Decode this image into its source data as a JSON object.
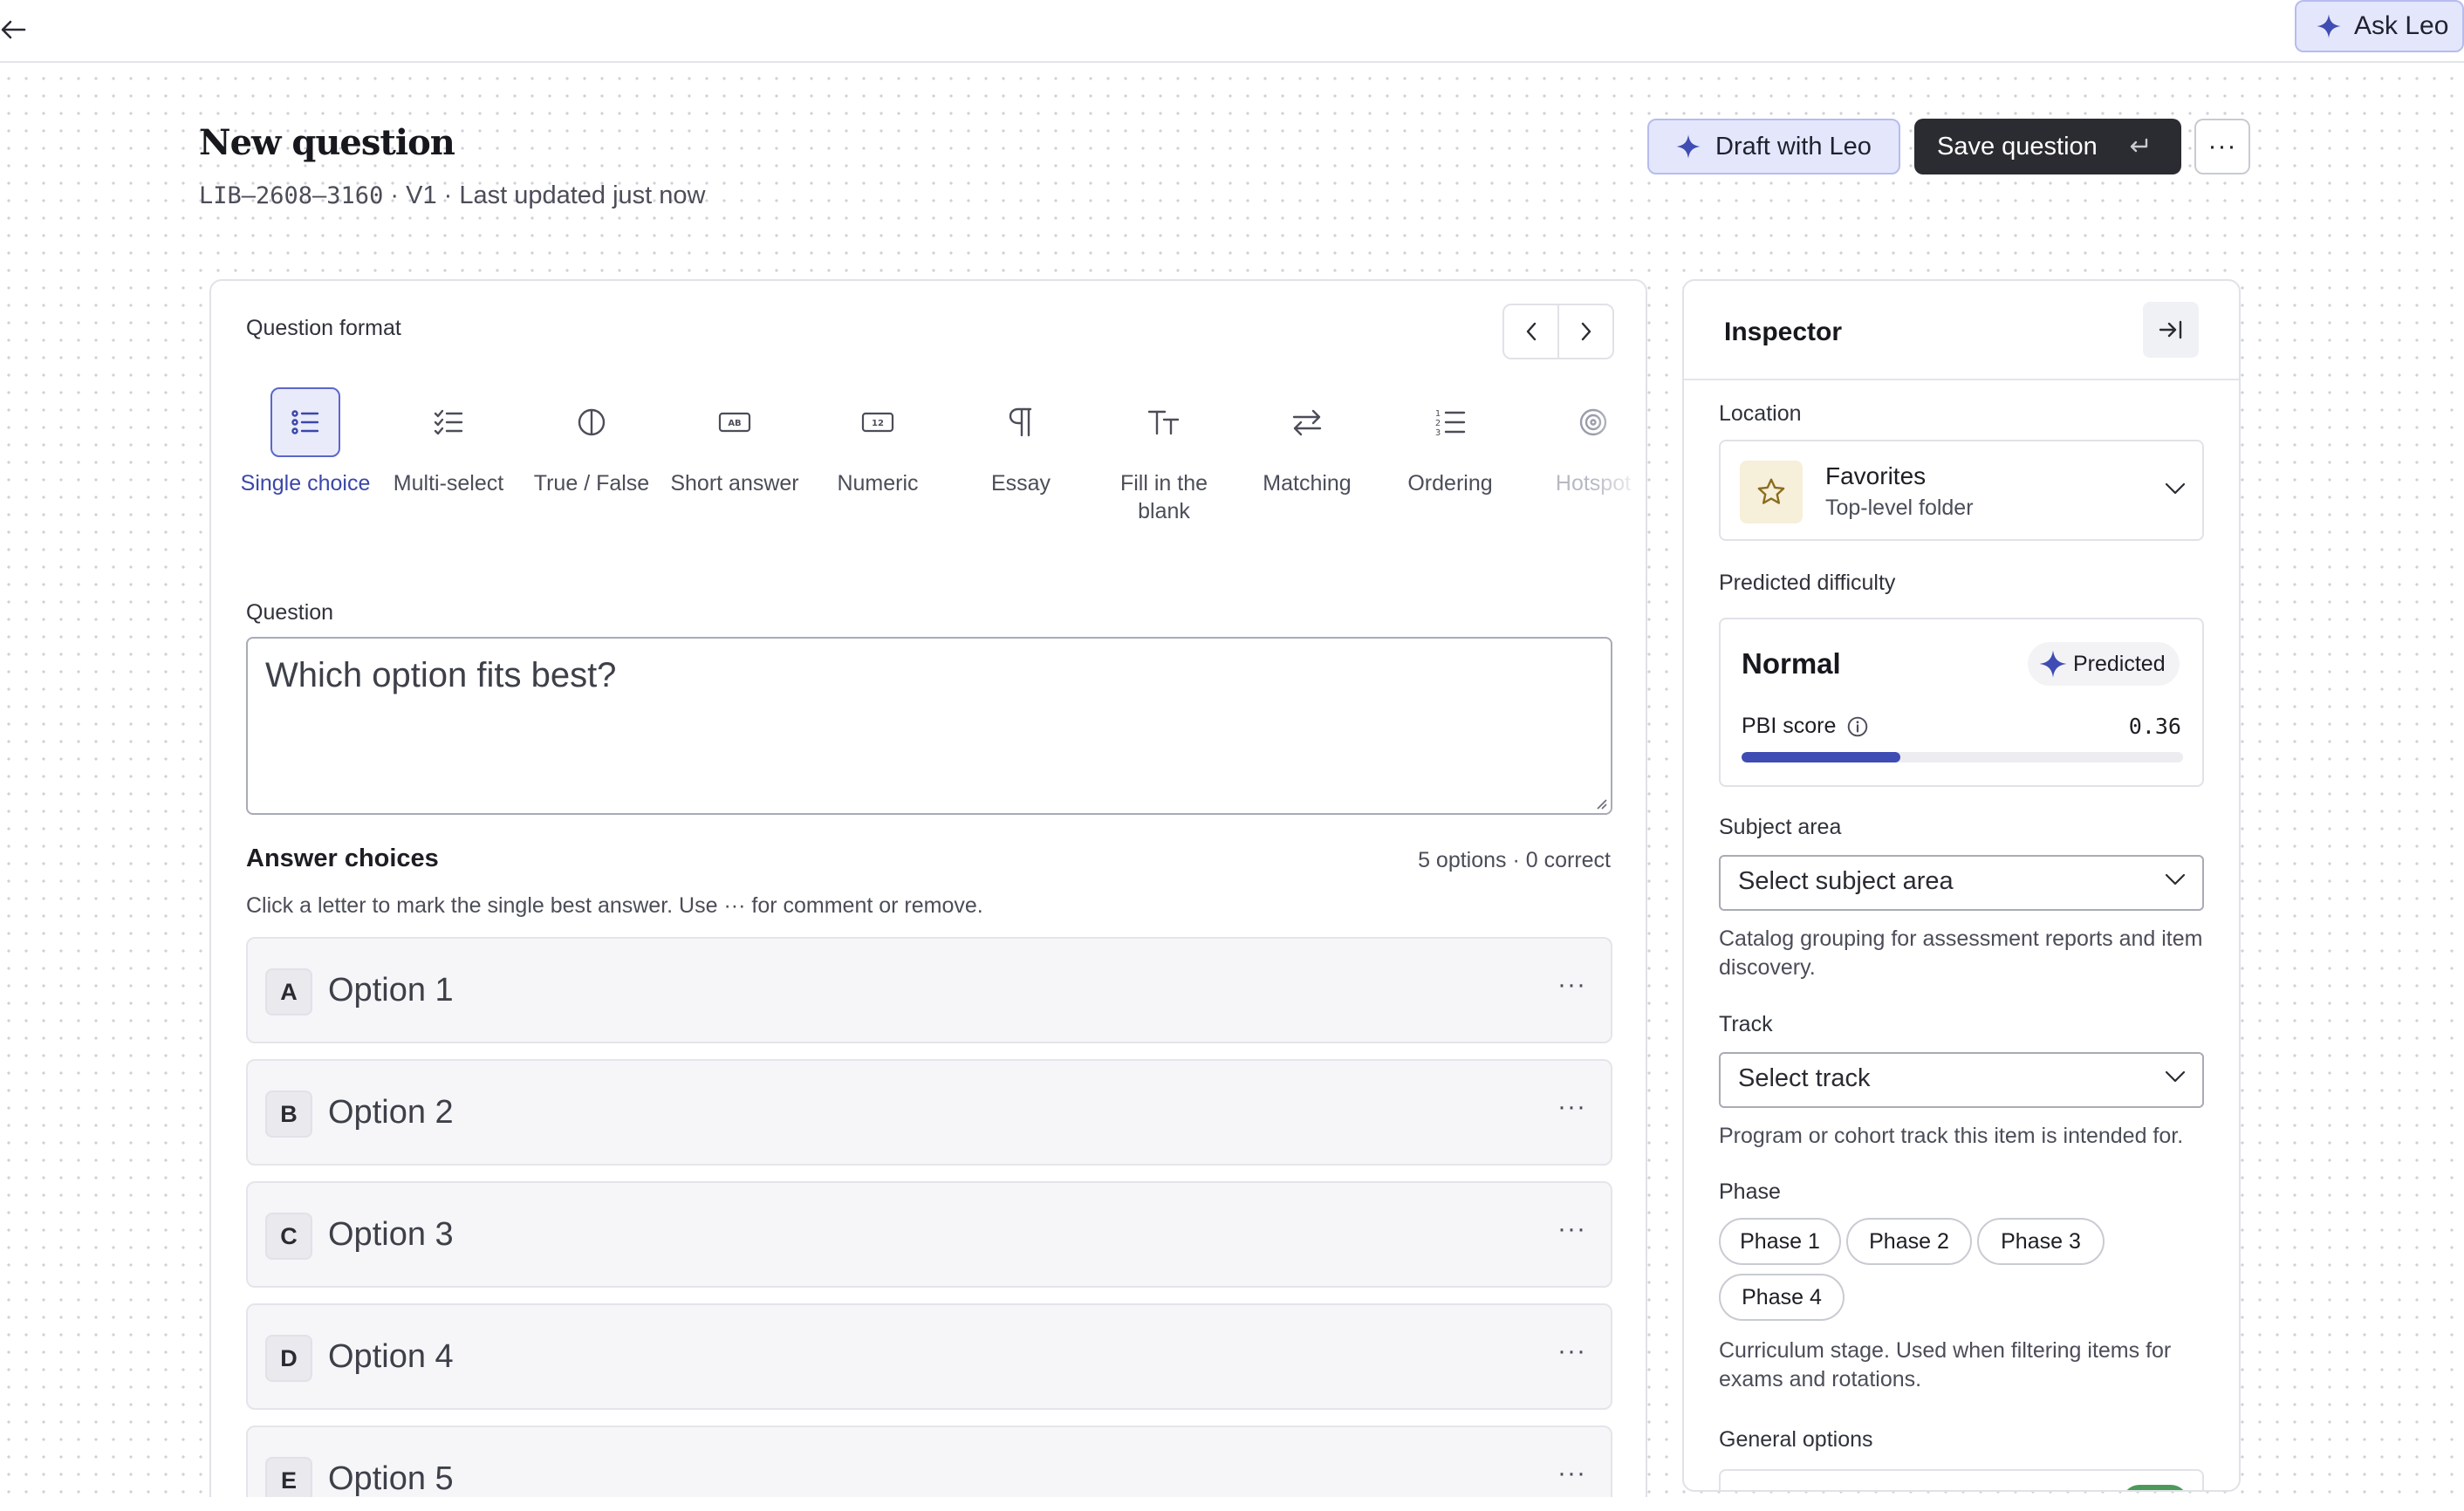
{
  "topbar": {
    "back_icon": "arrow-left-icon",
    "ask_leo_label": "Ask Leo"
  },
  "header": {
    "title": "New question",
    "item_id": "LIB–2608–3160",
    "meta_rest": " · V1 · Last updated just now",
    "draft_label": "Draft with Leo",
    "save_label": "Save question",
    "more_label": "···"
  },
  "format": {
    "label": "Question format",
    "selected": "Single choice",
    "items": [
      {
        "label": "Single choice",
        "icon": "list-bullets-icon"
      },
      {
        "label": "Multi-select",
        "icon": "list-checks-icon"
      },
      {
        "label": "True / False",
        "icon": "half-circle-icon"
      },
      {
        "label": "Short answer",
        "icon": "text-box-icon"
      },
      {
        "label": "Numeric",
        "icon": "number-box-icon"
      },
      {
        "label": "Essay",
        "icon": "pilcrow-icon"
      },
      {
        "label": "Fill in the blank",
        "icon": "text-size-icon"
      },
      {
        "label": "Matching",
        "icon": "swap-arrows-icon"
      },
      {
        "label": "Ordering",
        "icon": "numbered-list-icon"
      },
      {
        "label": "Hotspot",
        "icon": "target-icon"
      }
    ]
  },
  "question": {
    "label": "Question",
    "value": "Which option fits best?"
  },
  "answers": {
    "title": "Answer choices",
    "count": "5 options · 0 correct",
    "help": "Click a letter to mark the single best answer. Use ··· for comment or remove.",
    "options": [
      {
        "letter": "A",
        "text": "Option 1"
      },
      {
        "letter": "B",
        "text": "Option 2"
      },
      {
        "letter": "C",
        "text": "Option 3"
      },
      {
        "letter": "D",
        "text": "Option 4"
      },
      {
        "letter": "E",
        "text": "Option 5"
      }
    ],
    "more_label": "···"
  },
  "inspector": {
    "title": "Inspector",
    "location": {
      "label": "Location",
      "name": "Favorites",
      "sub": "Top-level folder"
    },
    "difficulty": {
      "label": "Predicted difficulty",
      "level": "Normal",
      "badge": "Predicted",
      "pbi_label": "PBI score",
      "pbi_value": "0.36",
      "pbi_fraction": 0.36
    },
    "subject": {
      "label": "Subject area",
      "placeholder": "Select subject area",
      "help": "Catalog grouping for assessment reports and item discovery."
    },
    "track": {
      "label": "Track",
      "placeholder": "Select track",
      "help": "Program or cohort track this item is intended for."
    },
    "phase": {
      "label": "Phase",
      "chips": [
        "Phase 1",
        "Phase 2",
        "Phase 3",
        "Phase 4"
      ],
      "help": "Curriculum stage. Used when filtering items for exams and rotations."
    },
    "general": {
      "label": "General options",
      "toggle_on": true
    }
  },
  "colors": {
    "accent": "#3f4cb3",
    "accent_soft": "#e4e7fb",
    "dark_button": "#2b2c31",
    "toggle_on": "#4c9a5b",
    "star": "#8a6d1e"
  }
}
